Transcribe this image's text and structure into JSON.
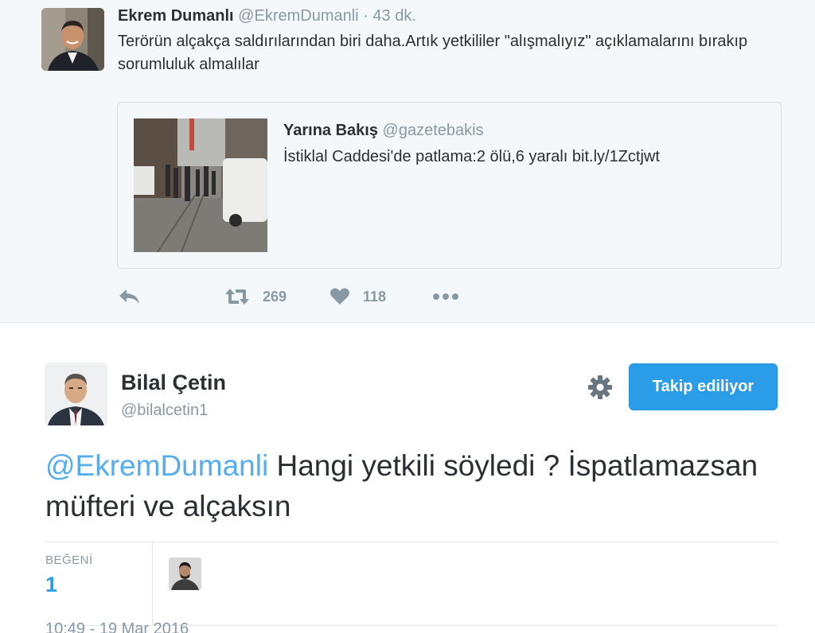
{
  "parent_tweet": {
    "name": "Ekrem Dumanlı",
    "handle": "@EkremDumanli",
    "separator": "·",
    "time": "43 dk.",
    "text": "Terörün alçakça saldırılarından biri daha.Artık yetkililer \"alışmalıyız\" açıklamalarını bırakıp sorumluluk almalılar",
    "quoted": {
      "name": "Yarına Bakış",
      "handle": "@gazetebakis",
      "text": "İstiklal Caddesi'de patlama:2 ölü,6 yaralı bit.ly/1Zctjwt"
    },
    "actions": {
      "reply_icon": "reply-icon",
      "retweet_icon": "retweet-icon",
      "retweet_count": "269",
      "like_icon": "heart-icon",
      "like_count": "118",
      "more_icon": "more-icon"
    }
  },
  "main_tweet": {
    "name": "Bilal Çetin",
    "handle": "@bilalcetin1",
    "follow_label": "Takip ediliyor",
    "mention": "@EkremDumanli",
    "text": " Hangi yetkili söyledi ? İspatlamazsan müfteri ve alçaksın",
    "likes_label": "BEĞENİ",
    "likes_count": "1",
    "timestamp": "10:49 - 19 Mar 2016"
  },
  "colors": {
    "accent": "#2b9ce8",
    "mention": "#55acee",
    "muted": "#8899a6",
    "parent_bg": "#f5f8fa"
  }
}
